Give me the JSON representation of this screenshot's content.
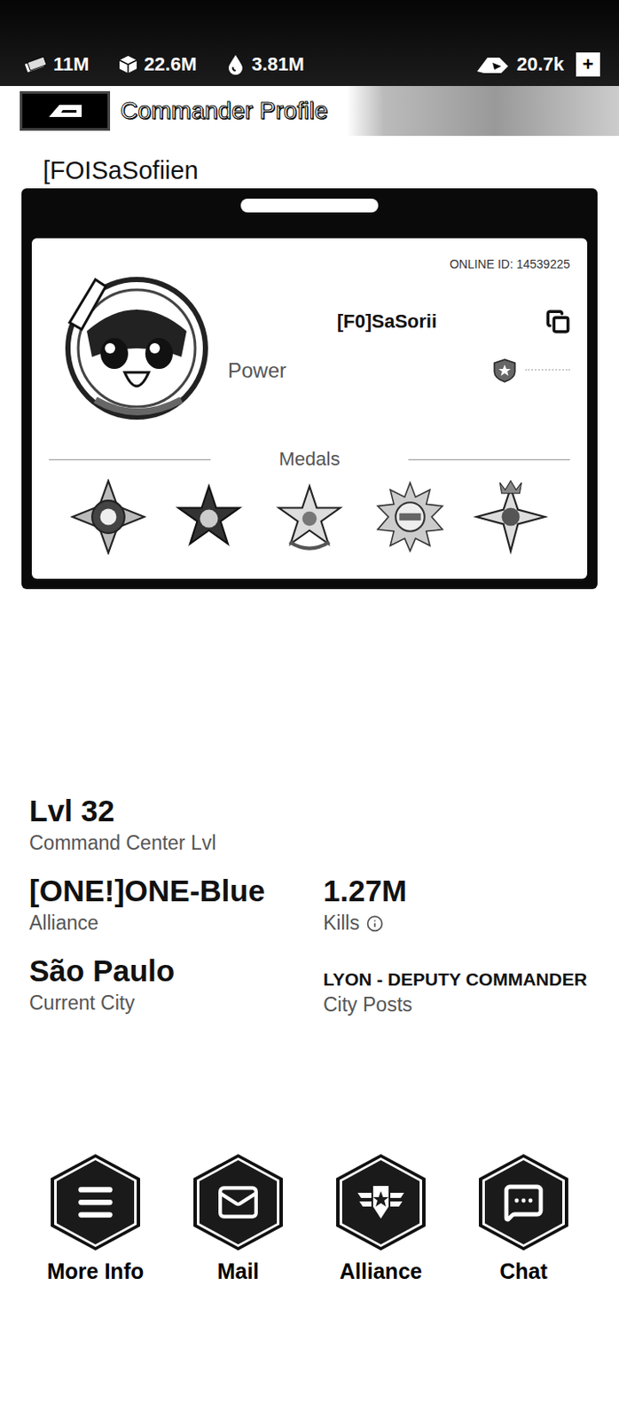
{
  "resources": [
    {
      "kind": "cash",
      "value": "11M"
    },
    {
      "kind": "crate",
      "value": "22.6M"
    },
    {
      "kind": "oil",
      "value": "3.81M"
    }
  ],
  "premium": {
    "value": "20.7k",
    "add": "+"
  },
  "header": {
    "title": "Commander Profile"
  },
  "player_name": "[FOISaSofiien",
  "card": {
    "online_id": "ONLINE ID: 14539225",
    "name": "[F0]SaSorii",
    "power_label": "Power",
    "medals_label": "Medals",
    "medals": [
      {
        "kind": "cross"
      },
      {
        "kind": "star"
      },
      {
        "kind": "wreath"
      },
      {
        "kind": "sun"
      },
      {
        "kind": "crown"
      }
    ]
  },
  "level": {
    "value": "Lvl 32",
    "label": "Command Center Lvl"
  },
  "stats": [
    {
      "value": "[ONE!]ONE-Blue",
      "label": "Alliance",
      "kind": "plain"
    },
    {
      "value": "1.27M",
      "label": "Kills",
      "kind": "info"
    },
    {
      "value": "São Paulo",
      "label": "Current City",
      "kind": "plain"
    },
    {
      "value": "LYON - DEPUTY COMMANDER",
      "label": "City Posts",
      "kind": "small"
    }
  ],
  "actions": [
    {
      "label": "More Info",
      "kind": "menu"
    },
    {
      "label": "Mail",
      "kind": "mail"
    },
    {
      "label": "Alliance",
      "kind": "alliance"
    },
    {
      "label": "Chat",
      "kind": "chat"
    }
  ]
}
